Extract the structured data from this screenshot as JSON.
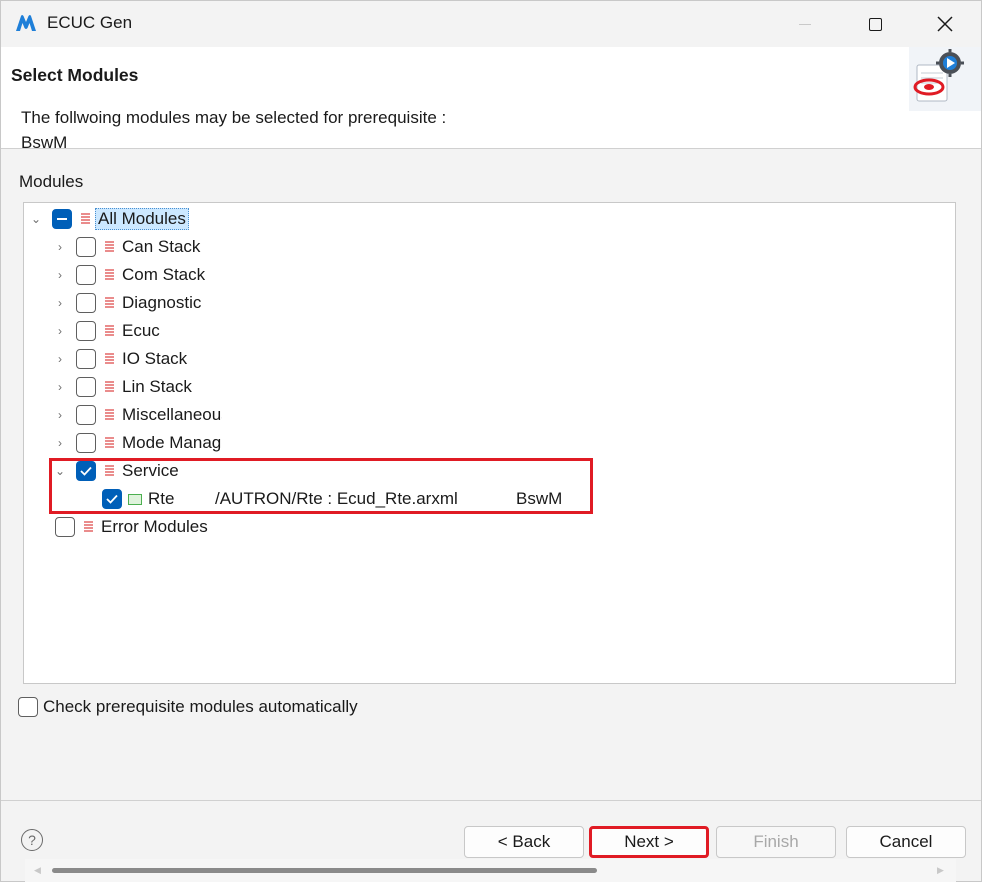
{
  "window": {
    "title": "ECUC Gen"
  },
  "header": {
    "title": "Select Modules",
    "description_line1": "The follwoing modules may be selected for prerequisite :",
    "description_line2": "BswM"
  },
  "modules": {
    "label": "Modules",
    "root": {
      "label": "All Modules",
      "state": "mixed"
    },
    "groups": [
      {
        "label": "Can Stack",
        "checked": false,
        "expanded": false
      },
      {
        "label": "Com Stack",
        "checked": false,
        "expanded": false
      },
      {
        "label": "Diagnostic",
        "checked": false,
        "expanded": false
      },
      {
        "label": "Ecuc",
        "checked": false,
        "expanded": false
      },
      {
        "label": "IO Stack",
        "checked": false,
        "expanded": false
      },
      {
        "label": "Lin Stack",
        "checked": false,
        "expanded": false
      },
      {
        "label": "Miscellaneous",
        "checked": false,
        "expanded": false
      },
      {
        "label": "Mode Management",
        "checked": false,
        "expanded": false
      },
      {
        "label": "Service",
        "checked": true,
        "expanded": true
      }
    ],
    "service_child": {
      "name": "Rte",
      "path": "/AUTRON/Rte : Ecud_Rte.arxml",
      "requiredBy": "BswM",
      "checked": true
    },
    "error_modules": {
      "label": "Error Modules",
      "checked": false
    }
  },
  "options": {
    "auto_check_label": "Check prerequisite modules automatically",
    "auto_check_checked": false
  },
  "buttons": {
    "back": "< Back",
    "next": "Next >",
    "finish": "Finish",
    "cancel": "Cancel",
    "help": "?"
  },
  "colors": {
    "accent": "#005fb8",
    "highlight": "#e01b24"
  }
}
